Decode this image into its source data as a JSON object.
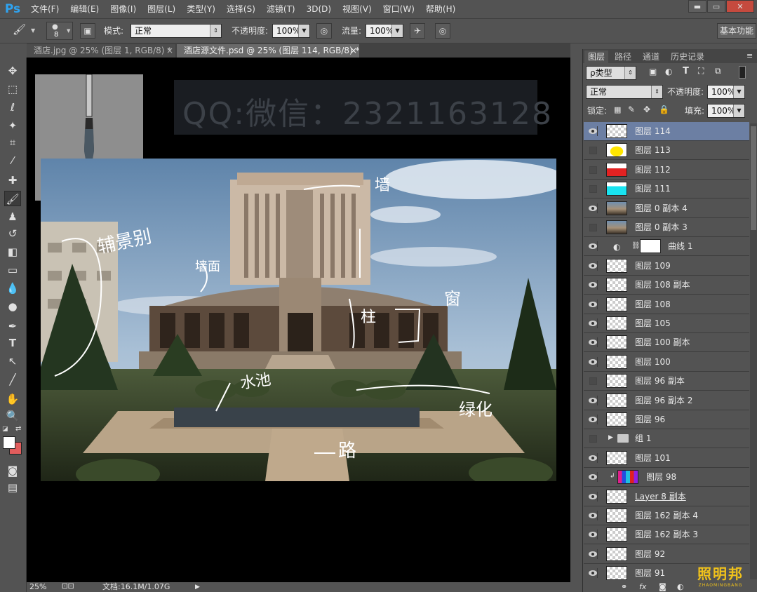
{
  "app": {
    "logo": "Ps",
    "menus": [
      "文件(F)",
      "编辑(E)",
      "图像(I)",
      "图层(L)",
      "类型(Y)",
      "选择(S)",
      "滤镜(T)",
      "3D(D)",
      "视图(V)",
      "窗口(W)",
      "帮助(H)"
    ],
    "win_minimize": "▬",
    "win_restore": "▭",
    "win_close": "✕"
  },
  "options": {
    "brush_size": "8",
    "mode_label": "模式:",
    "mode_value": "正常",
    "opacity_label": "不透明度:",
    "opacity_value": "100%",
    "flow_label": "流量:",
    "flow_value": "100%",
    "workspace": "基本功能"
  },
  "tabs": [
    {
      "label": "酒店.jpg @ 25% (图层 1, RGB/8) *",
      "active": false
    },
    {
      "label": "酒店源文件.psd @ 25% (图层 114, RGB/8) *",
      "active": true
    }
  ],
  "tab_close": "×",
  "canvas": {
    "watermark": "QQ:微信：2321163128",
    "annotations": [
      "辅景别",
      "墙",
      "墙面",
      "窗",
      "柱",
      "水池",
      "绿化",
      "路"
    ]
  },
  "status": {
    "zoom": "25%",
    "doc": "文档:16.1M/1.07G"
  },
  "panel": {
    "tabs": [
      "图层",
      "路径",
      "通道",
      "历史记录"
    ],
    "filter": "ρ类型",
    "blend": "正常",
    "opacity_label": "不透明度:",
    "opacity_value": "100%",
    "lock_label": "锁定:",
    "fill_label": "填充:",
    "fill_value": "100%",
    "layers": [
      {
        "name": "图层 114",
        "visible": true,
        "selected": true,
        "thumb": "blank"
      },
      {
        "name": "图层 113",
        "visible": false,
        "thumb": "yellow"
      },
      {
        "name": "图层 112",
        "visible": false,
        "thumb": "red"
      },
      {
        "name": "图层 111",
        "visible": false,
        "thumb": "cyan"
      },
      {
        "name": "图层 0 副本 4",
        "visible": true,
        "thumb": "photo"
      },
      {
        "name": "图层 0 副本 3",
        "visible": false,
        "thumb": "photo"
      },
      {
        "name": "曲线 1",
        "visible": true,
        "thumb": "adjust"
      },
      {
        "name": "图层 109",
        "visible": true,
        "thumb": "blank"
      },
      {
        "name": "图层 108 副本",
        "visible": true,
        "thumb": "blank"
      },
      {
        "name": "图层 108",
        "visible": true,
        "thumb": "blank"
      },
      {
        "name": "图层 105",
        "visible": true,
        "thumb": "blank"
      },
      {
        "name": "图层 100 副本",
        "visible": true,
        "thumb": "blank"
      },
      {
        "name": "图层 100",
        "visible": true,
        "thumb": "blank"
      },
      {
        "name": "图层 96 副本",
        "visible": false,
        "thumb": "blank"
      },
      {
        "name": "图层 96 副本 2",
        "visible": true,
        "thumb": "blank"
      },
      {
        "name": "图层 96",
        "visible": true,
        "thumb": "blank"
      },
      {
        "name": "组 1",
        "visible": false,
        "thumb": "folder"
      },
      {
        "name": "图层 101",
        "visible": true,
        "thumb": "blank"
      },
      {
        "name": "图层 98",
        "visible": true,
        "thumb": "color"
      },
      {
        "name": "Layer 8 副本",
        "visible": true,
        "thumb": "blank"
      },
      {
        "name": "图层 162 副本 4",
        "visible": true,
        "thumb": "blank"
      },
      {
        "name": "图层 162 副本 3",
        "visible": true,
        "thumb": "blank"
      },
      {
        "name": "图层 92",
        "visible": true,
        "thumb": "blank"
      },
      {
        "name": "图层 91",
        "visible": true,
        "thumb": "blank"
      }
    ]
  },
  "brand": "照明邦",
  "brand_sub": "ZHAOMINGBANG"
}
